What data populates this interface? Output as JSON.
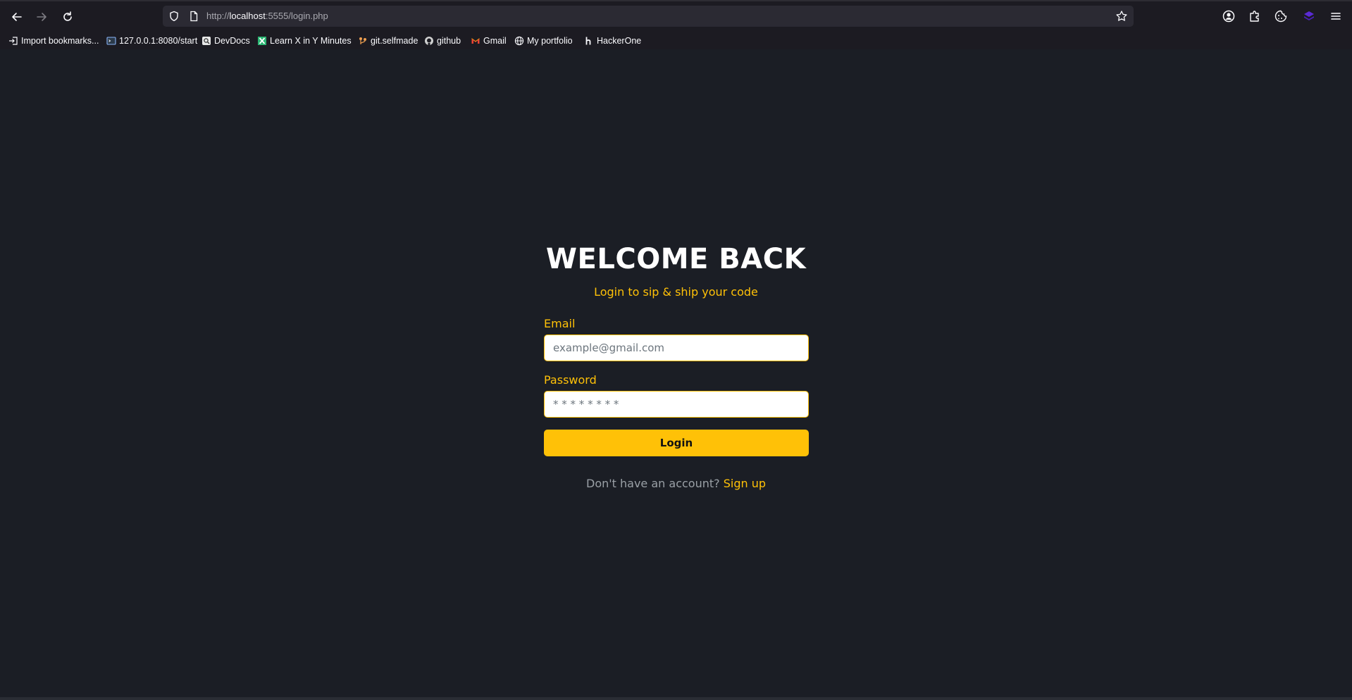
{
  "browser": {
    "url_scheme": "http://",
    "url_host": "localhost",
    "url_rest": ":5555/login.php",
    "bookmarks": [
      {
        "label": "Import bookmarks...",
        "icon": "import-icon"
      },
      {
        "label": "127.0.0.1:8080/start",
        "icon": "terminal-icon"
      },
      {
        "label": "DevDocs",
        "icon": "devdocs-icon"
      },
      {
        "label": "Learn X in Y Minutes",
        "icon": "learnx-icon"
      },
      {
        "label": "git.selfmade",
        "icon": "git-icon"
      },
      {
        "label": "github",
        "icon": "github-icon"
      },
      {
        "label": "Gmail",
        "icon": "gmail-icon"
      },
      {
        "label": "My portfolio",
        "icon": "globe-icon"
      },
      {
        "label": "HackerOne",
        "icon": "hackerone-icon"
      }
    ]
  },
  "login": {
    "title": "WELCOME BACK",
    "subtitle": "Login to sip & ship your code",
    "email_label": "Email",
    "email_placeholder": "example@gmail.com",
    "password_label": "Password",
    "password_placeholder": "* * * * * * * *",
    "submit_label": "Login",
    "signup_prompt": "Don't have an account?",
    "signup_link": "Sign up"
  },
  "colors": {
    "accent": "#ffc107",
    "background": "#1b1e25",
    "chrome": "#1c1b22",
    "urlbar": "#2b2a33"
  }
}
